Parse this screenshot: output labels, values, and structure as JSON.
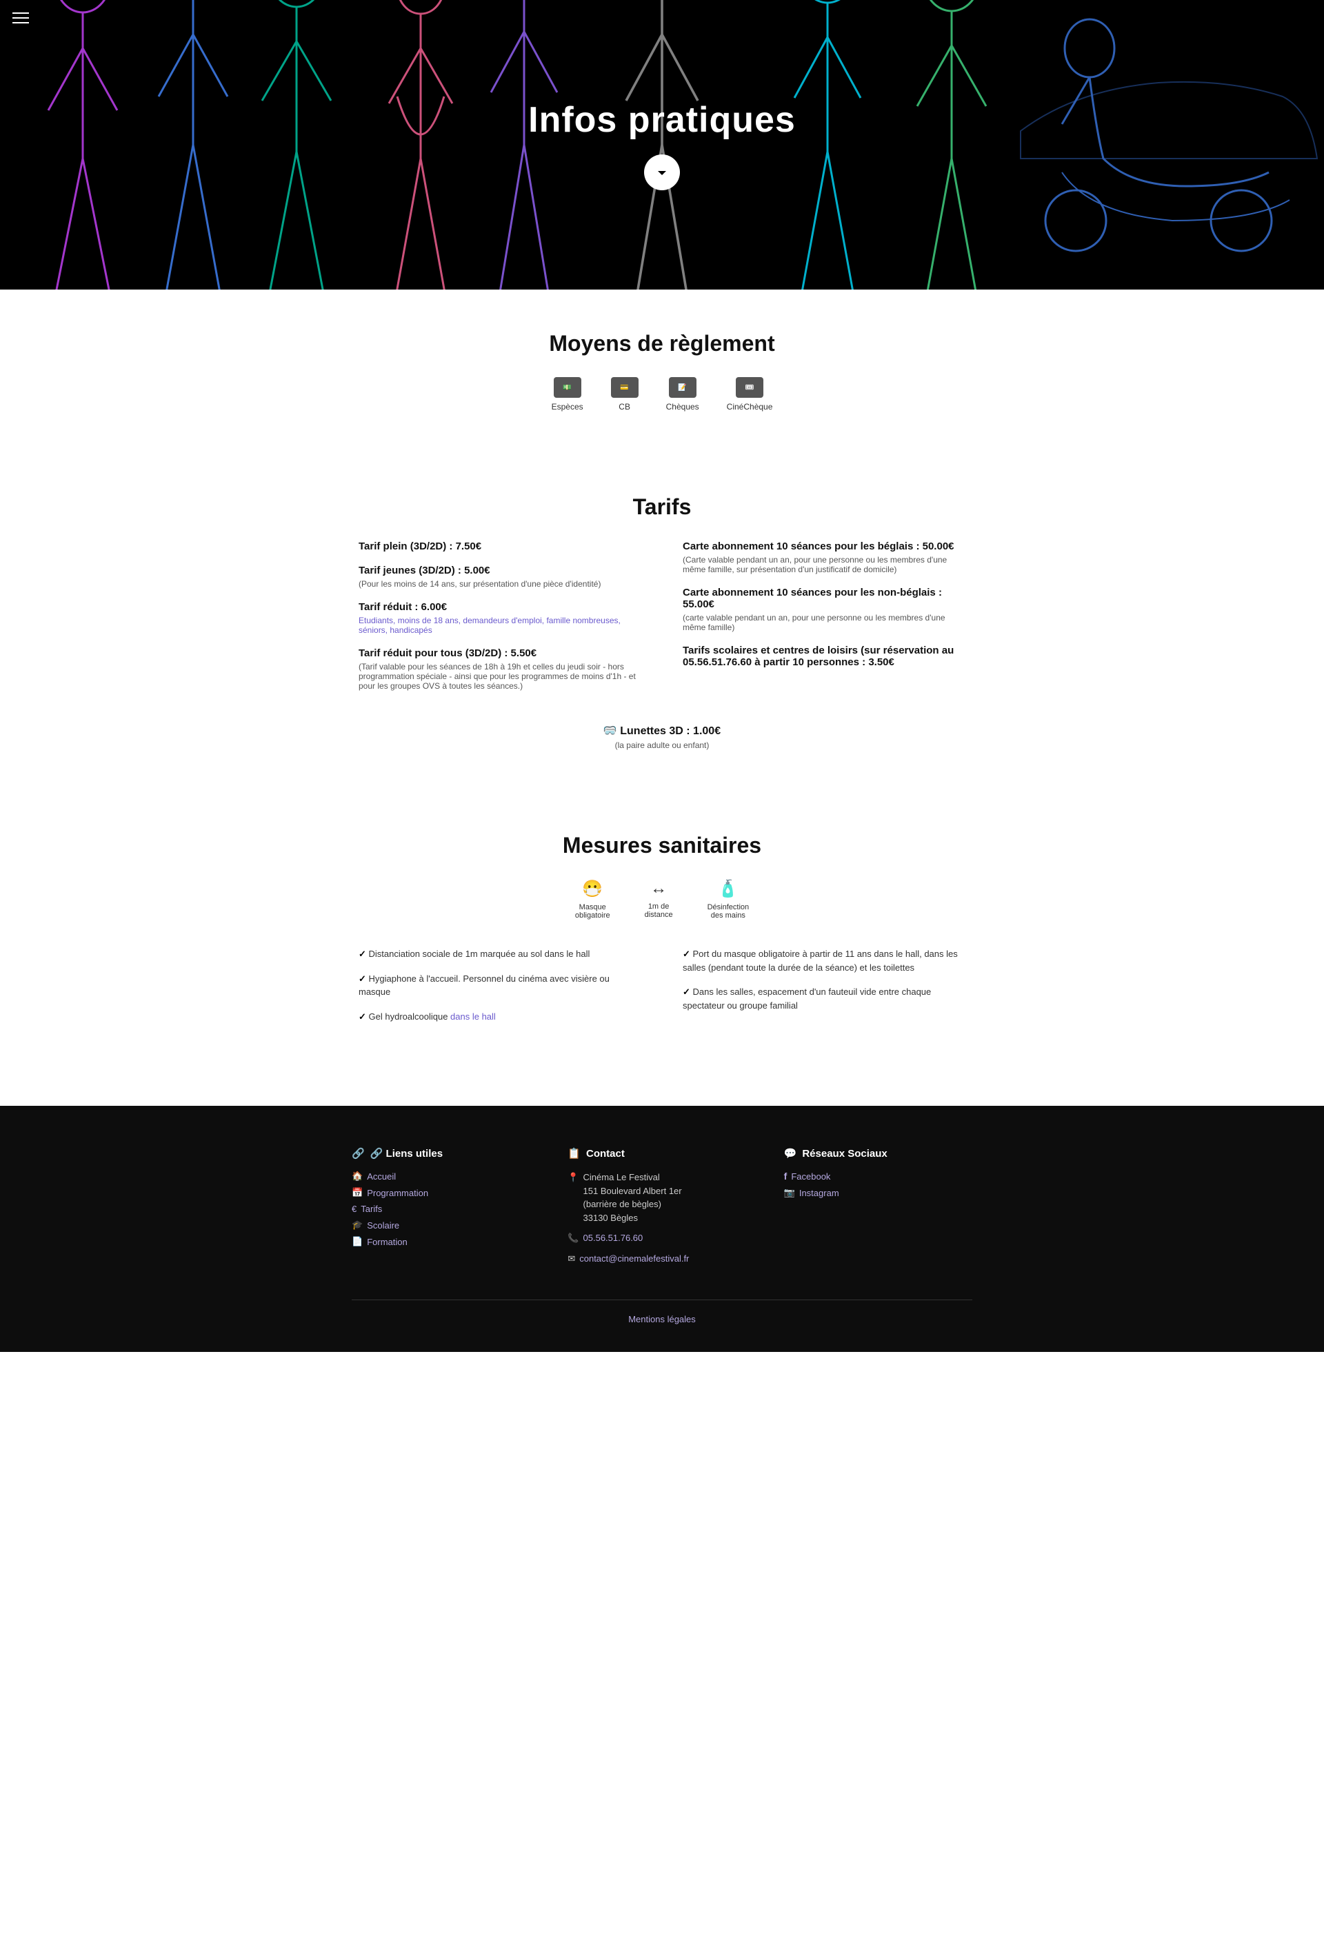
{
  "hero": {
    "title": "Infos pratiques",
    "arrow_label": "scroll down"
  },
  "hamburger": {
    "label": "menu"
  },
  "payment": {
    "section_title": "Moyens de règlement",
    "items": [
      {
        "label": "Espèces",
        "icon": "💵"
      },
      {
        "label": "CB",
        "icon": "💳"
      },
      {
        "label": "Chèques",
        "icon": "📝"
      },
      {
        "label": "CinéChèque",
        "icon": "🎟"
      }
    ]
  },
  "tarifs": {
    "section_title": "Tarifs",
    "left": [
      {
        "title": "Tarif plein (3D/2D) : 7.50€",
        "subtitle": ""
      },
      {
        "title": "Tarif jeunes (3D/2D) : 5.00€",
        "subtitle": "(Pour les moins de 14 ans, sur présentation d'une pièce d'identité)"
      },
      {
        "title": "Tarif réduit : 6.00€",
        "subtitle": "Etudiants, moins de 18 ans, demandeurs d'emploi, famille nombreuses, séniors, handicapés",
        "subtitle_link": true
      },
      {
        "title": "Tarif réduit pour tous (3D/2D) : 5.50€",
        "subtitle": "(Tarif valable pour les séances de 18h à 19h et celles du jeudi soir - hors programmation spéciale - ainsi que pour les programmes de moins d'1h - et pour les groupes OVS à toutes les séances.)"
      }
    ],
    "right": [
      {
        "title": "Carte abonnement 10 séances pour les béglais : 50.00€",
        "subtitle": "(Carte valable pendant un an, pour une personne ou les membres d'une même famille, sur présentation d'un justificatif de domicile)"
      },
      {
        "title": "Carte abonnement 10 séances pour les non-béglais : 55.00€",
        "subtitle": "(carte valable pendant un an, pour une personne ou les membres d'une même famille)"
      },
      {
        "title": "Tarifs scolaires et centres de loisirs (sur réservation au 05.56.51.76.60 à partir 10 personnes : 3.50€",
        "subtitle": ""
      }
    ],
    "glasses": "🥽 Lunettes 3D : 1.00€",
    "glasses_sub": "(la paire adulte ou enfant)"
  },
  "sanitaires": {
    "section_title": "Mesures sanitaires",
    "icons": [
      {
        "icon": "😷",
        "label": "Masque\nobligatoire"
      },
      {
        "icon": "↔",
        "label": "1m de\ndistance"
      },
      {
        "icon": "🧴",
        "label": "Désinfection\ndes mains"
      }
    ],
    "checks_left": [
      "Distanciation sociale de 1m marquée au sol dans le hall",
      "Hygiaphone à l'accueil. Personnel du cinéma avec visière ou masque",
      "Gel hydroalcoolique dans le hall"
    ],
    "checks_right": [
      "Port du masque obligatoire à partir de 11 ans dans le hall, dans les salles (pendant toute la durée de la séance) et les toilettes",
      "Dans les salles, espacement d'un fauteuil vide entre chaque spectateur ou groupe familial"
    ],
    "checks_left_highlights": [
      2
    ],
    "checks_right_highlights": []
  },
  "footer": {
    "liens_title": "🔗 Liens utiles",
    "contact_title": "📋 Contact",
    "social_title": "💬 Réseaux Sociaux",
    "liens": [
      {
        "icon": "🏠",
        "label": "Accueil"
      },
      {
        "icon": "📅",
        "label": "Programmation"
      },
      {
        "icon": "€",
        "label": "Tarifs"
      },
      {
        "icon": "🎓",
        "label": "Scolaire"
      },
      {
        "icon": "📄",
        "label": "Formation"
      }
    ],
    "contact": {
      "address_icon": "📍",
      "address": "Cinéma Le Festival\n151 Boulevard Albert 1er\n(barrière de bègles)\n33130 Bègles",
      "phone_icon": "📞",
      "phone": "05.56.51.76.60",
      "email_icon": "✉",
      "email": "contact@cinemalefestival.fr"
    },
    "social": [
      {
        "icon": "f",
        "label": "Facebook"
      },
      {
        "icon": "📷",
        "label": "Instagram"
      }
    ],
    "mentions_legales": "Mentions légales"
  }
}
